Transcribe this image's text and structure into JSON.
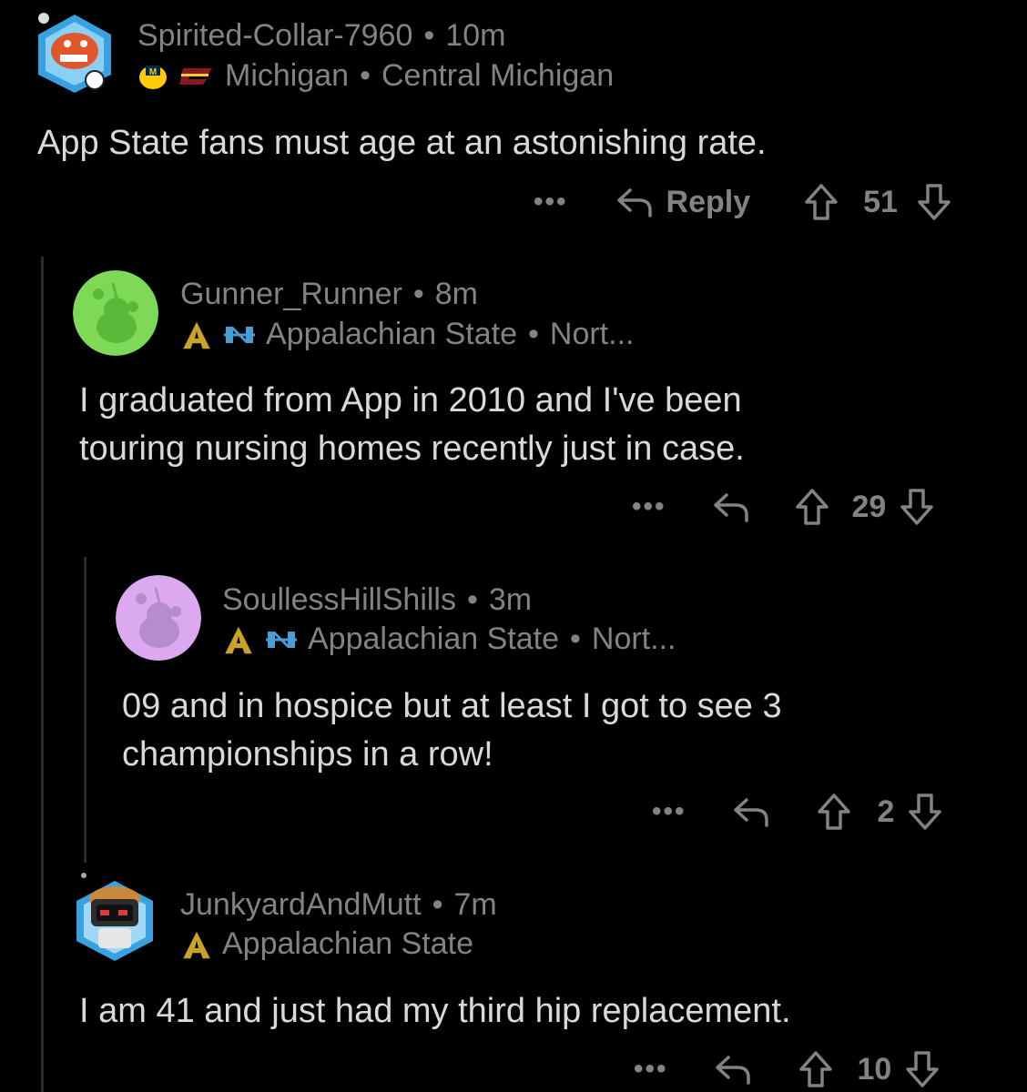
{
  "comments": [
    {
      "username": "Spirited-Collar-7960",
      "time": "10m",
      "flairs": [
        "Michigan",
        "Central Michigan"
      ],
      "body": [
        "App State fans must age at an astonishing rate."
      ],
      "reply_label": "Reply",
      "votes": "51"
    },
    {
      "username": "Gunner_Runner",
      "time": "8m",
      "flairs": [
        "Appalachian State",
        "Nort..."
      ],
      "body": [
        "I graduated from App in 2010 and I've been",
        "touring nursing homes recently just in case."
      ],
      "votes": "29",
      "avatar_color": "#7ed957"
    },
    {
      "username": "SoullessHillShills",
      "time": "3m",
      "flairs": [
        "Appalachian State",
        "Nort..."
      ],
      "body": [
        "09 and in hospice but at least I got to see 3",
        "championships in a row!"
      ],
      "votes": "2",
      "avatar_color": "#dca8f0"
    },
    {
      "username": "JunkyardAndMutt",
      "time": "7m",
      "flairs": [
        "Appalachian State"
      ],
      "body": [
        "I am 41 and just had my third hip replacement."
      ],
      "votes": "10"
    }
  ],
  "icons": {
    "more": "more-icon",
    "reply": "reply-arrow-icon",
    "upvote": "upvote-arrow-icon",
    "downvote": "downvote-arrow-icon"
  },
  "colors": {
    "background": "#000000",
    "text": "#d7dadc",
    "meta": "#818384",
    "thread_line": "#2a2a2a",
    "cmu_maroon": "#8a1a22",
    "app_gold": "#c9a227",
    "unc_blue": "#4b9cd3"
  }
}
